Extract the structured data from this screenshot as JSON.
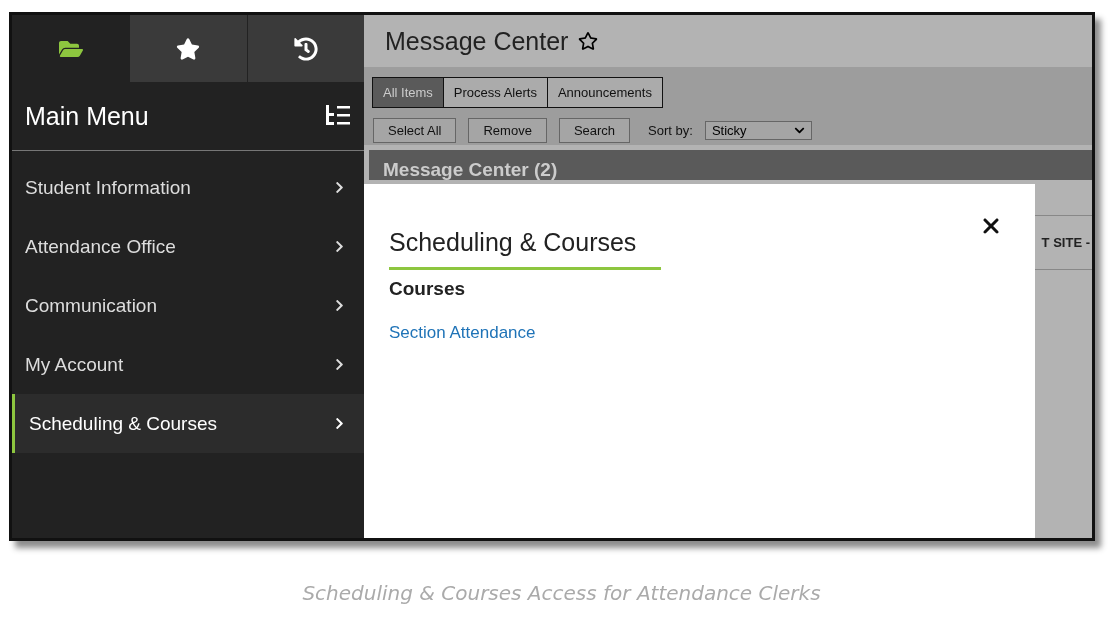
{
  "sidebar": {
    "tabs": [
      {
        "kind": "folder",
        "selected": true
      },
      {
        "kind": "star",
        "selected": false
      },
      {
        "kind": "history",
        "selected": false
      }
    ],
    "title": "Main Menu",
    "items": [
      {
        "label": "Student Information",
        "selected": false
      },
      {
        "label": "Attendance Office",
        "selected": false
      },
      {
        "label": "Communication",
        "selected": false
      },
      {
        "label": "My Account",
        "selected": false
      },
      {
        "label": "Scheduling & Courses",
        "selected": true
      }
    ]
  },
  "header": {
    "title": "Message Center"
  },
  "tabs": [
    {
      "label": "All Items",
      "selected": true
    },
    {
      "label": "Process Alerts",
      "selected": false
    },
    {
      "label": "Announcements",
      "selected": false
    }
  ],
  "buttons": [
    "Select All",
    "Remove",
    "Search"
  ],
  "sort": {
    "label": "Sort by:",
    "value": "Sticky"
  },
  "panel": {
    "title": "Message Center (2)",
    "column_1": "T SITE -"
  },
  "modal": {
    "title": "Scheduling & Courses",
    "section": "Courses",
    "links": [
      "Section Attendance"
    ]
  },
  "caption": "Scheduling & Courses Access for Attendance Clerks"
}
